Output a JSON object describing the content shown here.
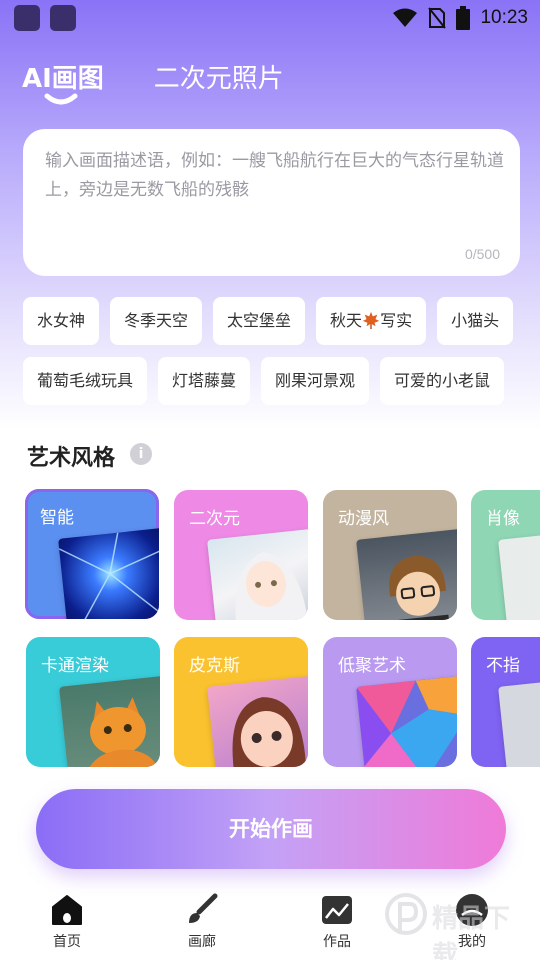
{
  "status_bar": {
    "time": "10:23"
  },
  "tabs": [
    {
      "label": "AI画图",
      "active": true
    },
    {
      "label": "二次元照片",
      "active": false
    }
  ],
  "prompt": {
    "placeholder": "输入画面描述语，例如：一艘飞船航行在巨大的气态行星轨道上，旁边是无数飞船的残骸",
    "counter": "0/500"
  },
  "chips_row1": [
    "水女神",
    "冬季天空",
    "太空堡垒",
    "秋天",
    "写实",
    "小猫头"
  ],
  "chips_row2": [
    "葡萄毛绒玩具",
    "灯塔藤蔓",
    "刚果河景观",
    "可爱的小老鼠"
  ],
  "section": {
    "title": "艺术风格",
    "info": "i"
  },
  "styles": [
    {
      "label": "智能",
      "selected": true,
      "bg": "#5b8ff0"
    },
    {
      "label": "二次元",
      "selected": false,
      "bg": "#ee8ae6"
    },
    {
      "label": "动漫风",
      "selected": false,
      "bg": "#c3b49f"
    },
    {
      "label": "肖像",
      "selected": false,
      "bg": "#8fd6b4"
    },
    {
      "label": "卡通渲染",
      "selected": false,
      "bg": "#38cbd8"
    },
    {
      "label": "皮克斯",
      "selected": false,
      "bg": "#f9c22e"
    },
    {
      "label": "低聚艺术",
      "selected": false,
      "bg": "#b99af0"
    },
    {
      "label": "不指",
      "selected": false,
      "bg": "#7f63f2"
    }
  ],
  "start_button": {
    "label": "开始作画"
  },
  "bottom_nav": [
    {
      "label": "首页",
      "icon": "home-icon",
      "active": true
    },
    {
      "label": "画廊",
      "icon": "brush-icon",
      "active": false
    },
    {
      "label": "作品",
      "icon": "image-icon",
      "active": false
    },
    {
      "label": "我的",
      "icon": "profile-icon",
      "active": false
    }
  ],
  "watermark": {
    "text": "精品下载"
  },
  "colors": {
    "accent": "#8a6df6",
    "pink": "#f07ad8",
    "selected_outline": "#8a66ee"
  }
}
